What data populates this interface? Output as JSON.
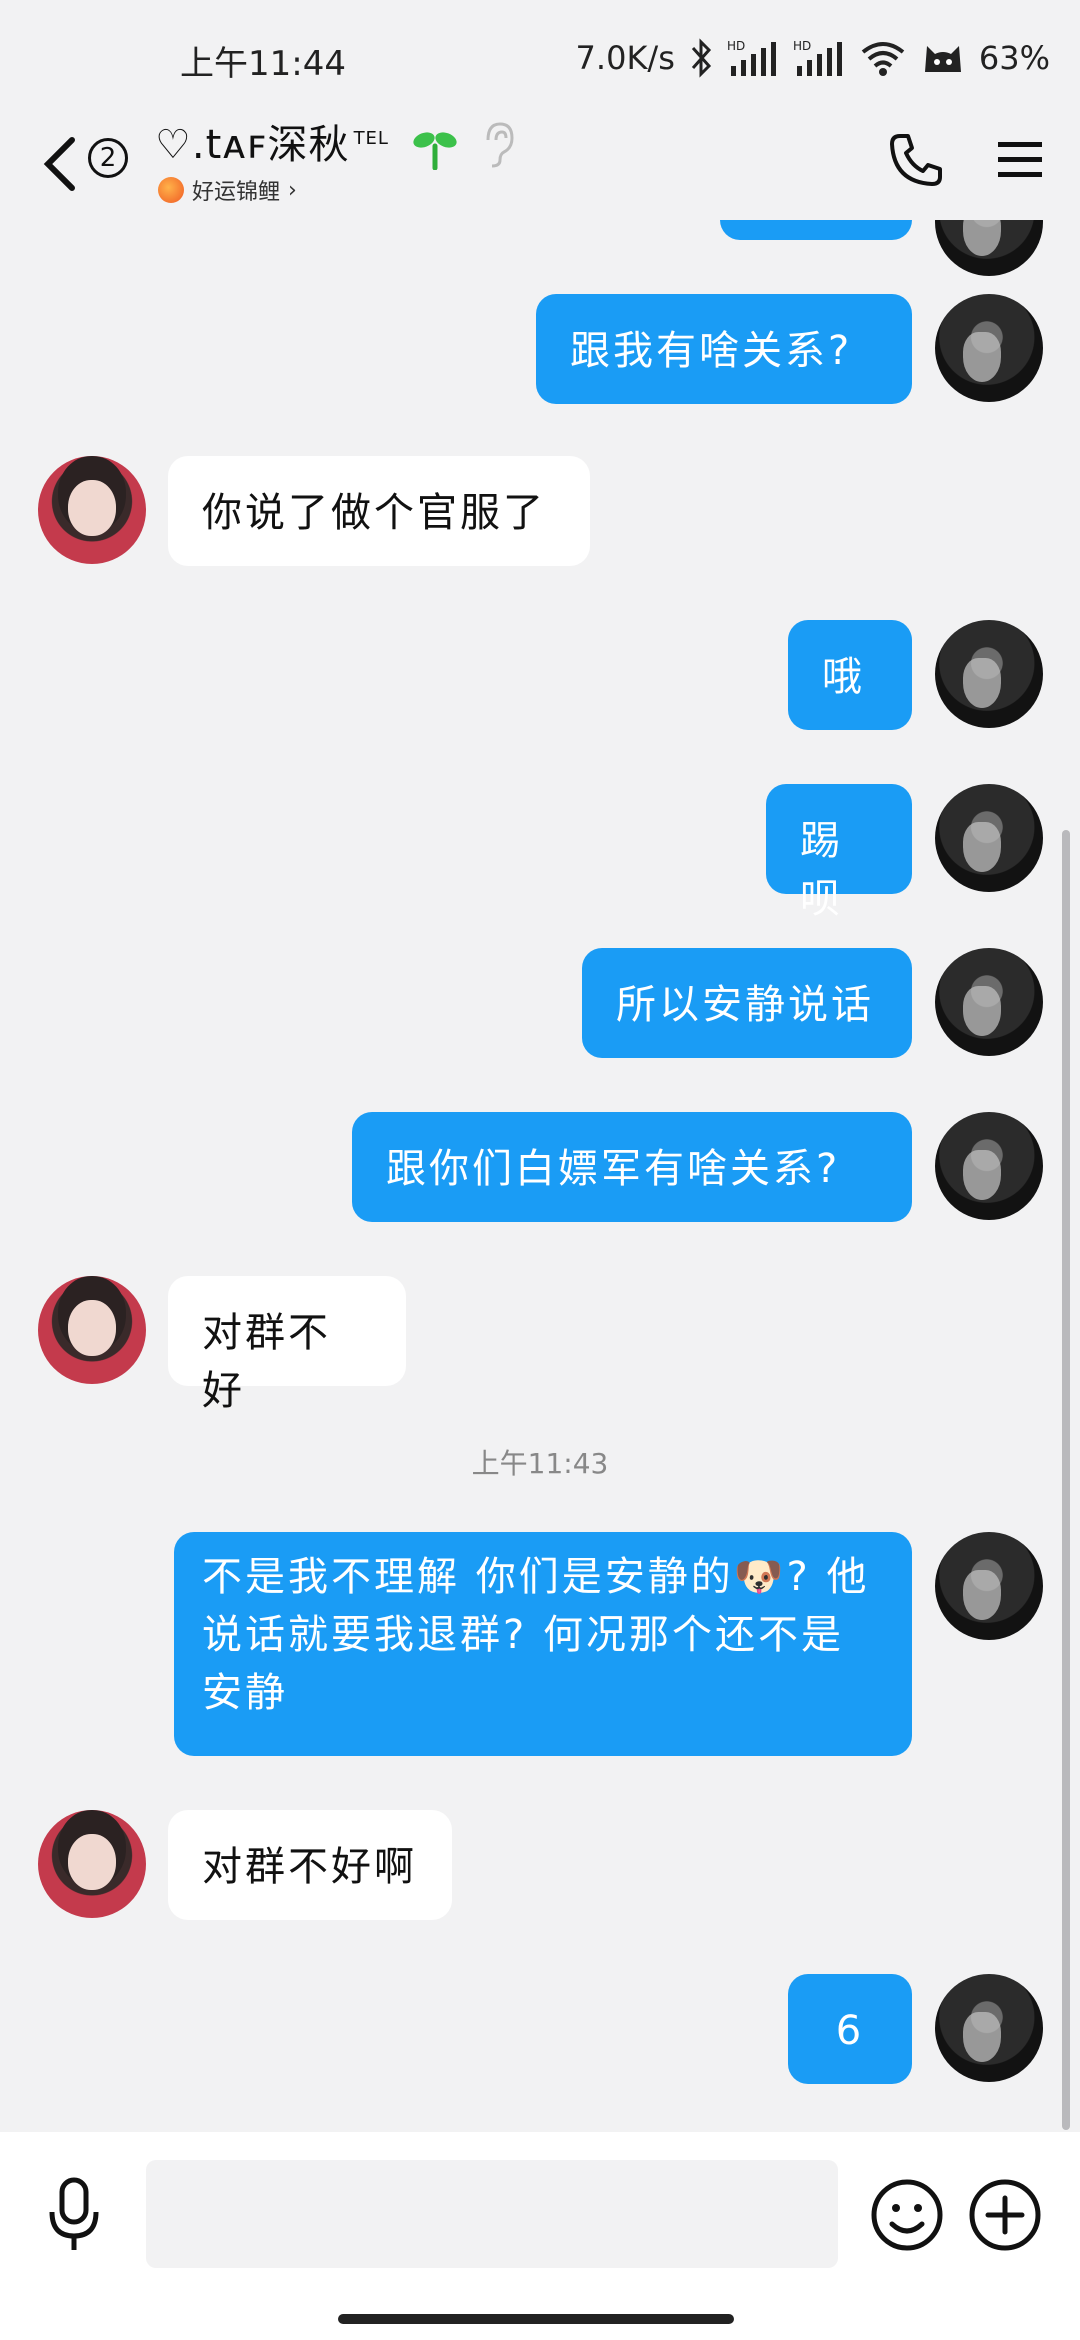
{
  "status_bar": {
    "time": "上午11:44",
    "network_speed": "7.0K/s",
    "battery": "63%",
    "icons": [
      "bluetooth-icon",
      "signal-hd-icon",
      "signal-hd-icon",
      "wifi-icon",
      "cat-icon"
    ]
  },
  "header": {
    "unread_count": "2",
    "title": "♡.tᴀꜰ深秋",
    "title_tag": "TEL",
    "subtitle": "好运锦鲤",
    "subtitle_chevron": "›"
  },
  "messages": [
    {
      "side": "me",
      "text": "跟我有啥关系?"
    },
    {
      "side": "other",
      "text": "你说了做个官服了"
    },
    {
      "side": "me",
      "text": "哦"
    },
    {
      "side": "me",
      "text": "踢呗"
    },
    {
      "side": "me",
      "text": "所以安静说话"
    },
    {
      "side": "me",
      "text": "跟你们白嫖军有啥关系?"
    },
    {
      "side": "other",
      "text": "对群不好"
    },
    {
      "timestamp": "上午11:43"
    },
    {
      "side": "me",
      "text": "不是我不理解 你们是安静的🐶? 他说话就要我退群? 何况那个还不是安静"
    },
    {
      "side": "other",
      "text": "对群不好啊"
    },
    {
      "side": "me",
      "text": "6"
    }
  ],
  "input": {
    "value": "",
    "placeholder": ""
  },
  "colors": {
    "my_bubble": "#1a9cf5",
    "other_bubble": "#ffffff",
    "background": "#f2f2f3"
  }
}
